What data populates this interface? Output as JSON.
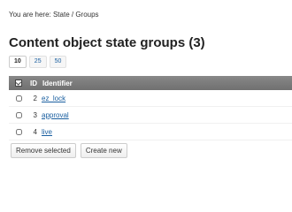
{
  "breadcrumb": "You are here: State / Groups",
  "page_title": "Content object state groups (3)",
  "pager": {
    "options": [
      "10",
      "25",
      "50"
    ],
    "active": "10"
  },
  "table": {
    "headers": {
      "id": "ID",
      "identifier": "Identifier"
    },
    "rows": [
      {
        "id": "2",
        "identifier": "ez_lock",
        "checked": false
      },
      {
        "id": "3",
        "identifier": "approval",
        "checked": false
      },
      {
        "id": "4",
        "identifier": "live",
        "checked": false
      }
    ]
  },
  "actions": {
    "remove_label": "Remove selected",
    "create_label": "Create new"
  },
  "icons": {
    "header_check": "checkbox-toggle-icon"
  },
  "colors": {
    "header_bg": "#7a7a7a",
    "link": "#1a5fa0"
  }
}
